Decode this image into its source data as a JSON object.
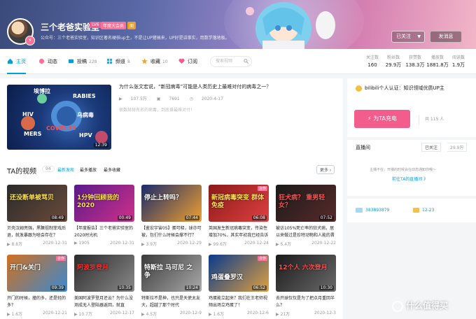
{
  "header": {
    "username": "三个老爸实验室",
    "level_badge": "LV6",
    "vip_badge": "年度大会员",
    "medal": "图",
    "signature": "公众号：三个老爸实验室，知识区著名硬核up主，不是让UP猪搞来，UP好是讲事实，用数学落地板。",
    "follow_button": "已关注",
    "message_button": "发消息"
  },
  "nav": {
    "items": [
      {
        "label": "主页",
        "count": "",
        "icon": "home-icon"
      },
      {
        "label": "动态",
        "count": "",
        "icon": "dynamic-icon"
      },
      {
        "label": "投稿",
        "count": "228",
        "icon": "upload-icon"
      },
      {
        "label": "频道",
        "count": "8",
        "icon": "channel-icon"
      },
      {
        "label": "收藏",
        "count": "10",
        "icon": "star-icon"
      },
      {
        "label": "订阅",
        "count": "",
        "icon": "heart-icon"
      }
    ],
    "search_placeholder": "搜索视频",
    "stats": [
      {
        "label": "关注数",
        "value": "160"
      },
      {
        "label": "粉丝数",
        "value": "29.9万"
      },
      {
        "label": "获赞数",
        "value": "138.3万"
      },
      {
        "label": "播放数",
        "value": "1881.8万"
      },
      {
        "label": "阅读数",
        "value": "1.9万"
      }
    ]
  },
  "featured": {
    "title": "为什么张文宏说，“新冠病毒”可能是人类历史上最难对付的病毒之一？",
    "views": "107.5万",
    "comments": "7691",
    "date": "2020-4-17",
    "description": "很数赫赫有名的病毒，到底谁最难对付！",
    "duration": "12:39",
    "thumb_labels": [
      "埃博拉",
      "RABIES",
      "HIV",
      "乌病毒",
      "MERS",
      "COVID-19",
      "HPV"
    ]
  },
  "videos_section": {
    "title": "TA的视频",
    "count": "94",
    "sorts": [
      "最新发布",
      "最多播放",
      "最多收藏"
    ],
    "more": "更多"
  },
  "videos": [
    {
      "title": "贝壳汉姆亮强，黑蹶祖制菲戏后退，就发暴跟为啥会存在？",
      "views": "8.8万",
      "date": "2020-12-31",
      "duration": "08:49",
      "caption": "还没断单被骂贝",
      "tag": ""
    },
    {
      "title": "【年度报告】三个老爸实验室的2020时光机",
      "views": "1905",
      "date": "2020-12-31",
      "duration": "00:49",
      "caption": "1分钟回顾我的2020",
      "tag": ""
    },
    {
      "title": "【鉴宏宇宙05】蛋可释，球亦可被，包们什么时候会撑不行？",
      "views": "3.9万",
      "date": "2020-12-29",
      "duration": "07:44",
      "caption": "停止上转吗？",
      "tag": ""
    },
    {
      "title": "英国发生新冠病毒突变，传染性增加70%，其实年初我已经告诉了",
      "views": "99.6万",
      "date": "2020-12-24",
      "duration": "06:08",
      "caption": "新冠病毒突变 群体免疫",
      "tag": "合作"
    },
    {
      "title": "被访105%死亡率的狂犬病，居以来做过是珍特动物和人能的晋",
      "views": "5.4万",
      "date": "2020-12-22",
      "duration": "07:52",
      "caption": "狂犬病？ 重男轻女？",
      "tag": ""
    },
    {
      "title": "开门的时候，撞的多，还是轻的多？",
      "views": "1.6万",
      "date": "2020-12-21",
      "duration": "09:39",
      "caption": "开门&关门",
      "tag": "合作"
    },
    {
      "title": "美国阿波罗登月还云？为什么没测成无人登陆器返回，就直",
      "views": "10.7万",
      "date": "2020-12-17",
      "duration": "10:35",
      "caption": "阿波罗登月",
      "tag": ""
    },
    {
      "title": "特斯拉不是神，也只是天使太友大，超越了那个时代",
      "views": "4.5万",
      "date": "2020-12-9",
      "duration": "10:24",
      "caption": "特斯拉 马可尼 之争",
      "tag": ""
    },
    {
      "title": "鸡蛋能立起来？我们在王老师视频出场立鸡蛋了！",
      "views": "1.6万",
      "date": "2020-12-6",
      "duration": "06:52",
      "caption": "鸡蛋叠罗汉",
      "tag": "合作"
    },
    {
      "title": "去开球仅仅是为了把点月重回半么？",
      "views": "21万",
      "date": "2020-12-3",
      "duration": "10:30",
      "caption": "12个人 六次登月",
      "tag": ""
    }
  ],
  "side": {
    "certification": "bilibili个人认证：知识领域优质UP主",
    "charge_button": "为TA充电",
    "charge_count": "共 115 人",
    "live_title": "直播间",
    "live_follow": "已关注",
    "live_fans": "29.9万",
    "live_note": "主播不在，开播的时候会在动态通知你哦～",
    "live_link": "前往TA的直播间 》",
    "uid": "383893879",
    "birthday": "12-23"
  },
  "watermark": "什么值得买",
  "colors": {
    "accent": "#00a1d6",
    "pink": "#fb7299",
    "bg": "#f4f5f7"
  }
}
